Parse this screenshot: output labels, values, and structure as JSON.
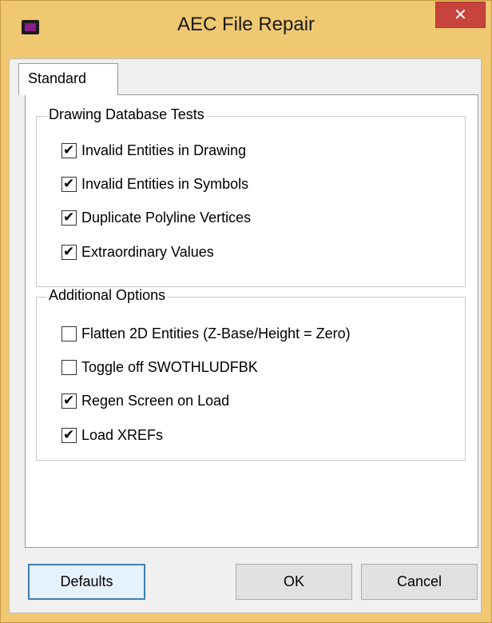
{
  "window": {
    "title": "AEC File Repair",
    "close_glyph": "✕"
  },
  "tabs": [
    {
      "label": "Standard",
      "selected": true
    }
  ],
  "groups": {
    "database_tests": {
      "legend": "Drawing Database Tests",
      "items": [
        {
          "label": "Invalid Entities in Drawing",
          "checked": true
        },
        {
          "label": "Invalid Entities in Symbols",
          "checked": true
        },
        {
          "label": "Duplicate Polyline Vertices",
          "checked": true
        },
        {
          "label": "Extraordinary Values",
          "checked": true
        }
      ]
    },
    "additional_options": {
      "legend": "Additional Options",
      "items": [
        {
          "label": "Flatten 2D Entities (Z-Base/Height = Zero)",
          "checked": false
        },
        {
          "label": "Toggle off SWOTHLUDFBK",
          "checked": false
        },
        {
          "label": "Regen Screen on Load",
          "checked": true
        },
        {
          "label": "Load XREFs",
          "checked": true
        }
      ]
    }
  },
  "buttons": {
    "defaults": "Defaults",
    "ok": "OK",
    "cancel": "Cancel"
  },
  "check_glyph": "✔",
  "colors": {
    "frame": "#f0c872",
    "close_button": "#c7443c",
    "default_button_border": "#3c7fb1"
  }
}
